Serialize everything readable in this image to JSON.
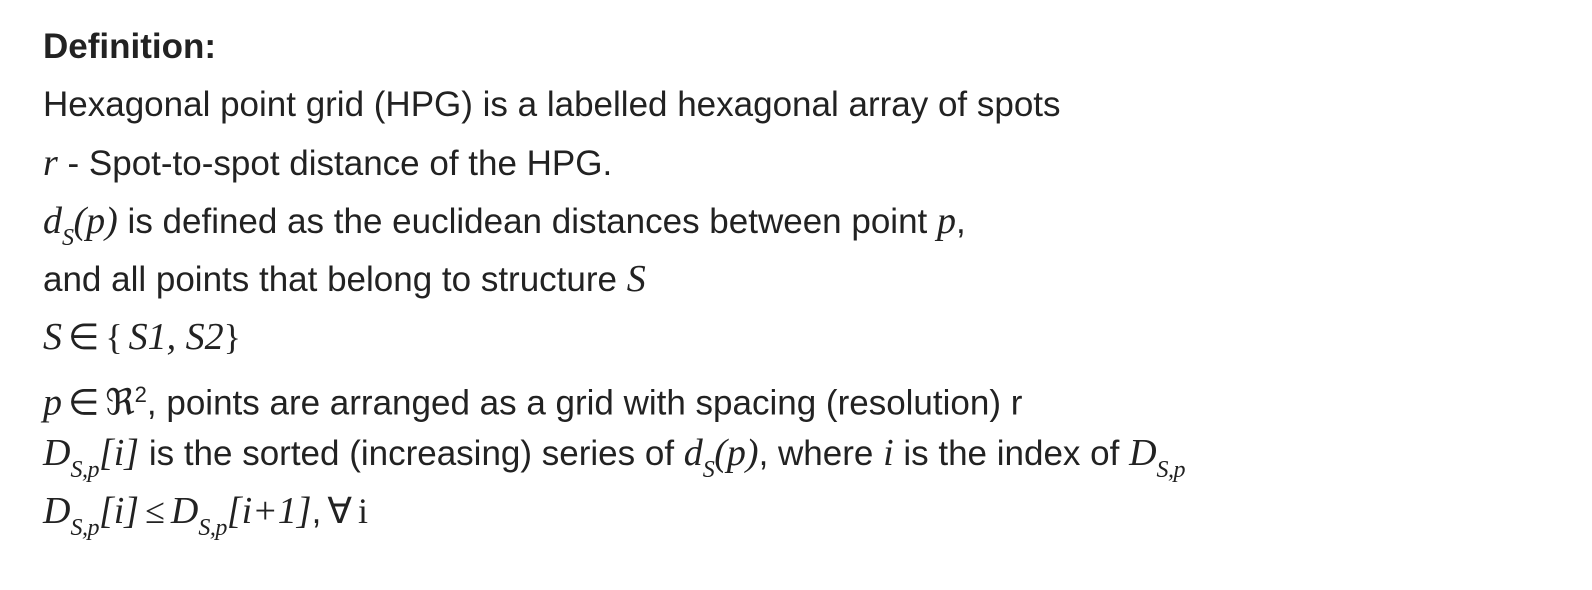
{
  "heading": "Definition:",
  "line1": "Hexagonal point grid (HPG) is a labelled hexagonal array of spots",
  "line2": {
    "sym": "r",
    "text": " - Spot-to-spot distance of the HPG."
  },
  "line3": {
    "d": "d",
    "sub": "S",
    "arg": "(p)",
    "text": " is defined as the euclidean distances between point ",
    "p": "p",
    "tail": ","
  },
  "line4": {
    "text": "and all points that belong to structure ",
    "S": "S"
  },
  "line5": {
    "S": "S",
    "in": "∈",
    "lb": "{",
    "set": "S1, S2",
    "rb": "}"
  },
  "line6": {
    "p": "p",
    "in": "∈",
    "R": "ℜ",
    "sup": "2",
    "text": ", points are arranged as a grid with spacing (resolution) r"
  },
  "line7": {
    "D": "D",
    "sub": "S,p",
    "idx": "[i]",
    "text1": " is the sorted (increasing) series of ",
    "d": "d",
    "dsub": "S",
    "darg": "(p)",
    "text2": ", where ",
    "i": "i",
    "text3": " is the index of ",
    "D2": "D",
    "sub2": "S,p"
  },
  "line8": {
    "D": "D",
    "sub": "S,p",
    "idx": "[i]",
    "le": "≤",
    "D2": "D",
    "sub2": "S,p",
    "idx2": "[i+1]",
    "comma": ",",
    "forall": "∀",
    "i": "i"
  }
}
